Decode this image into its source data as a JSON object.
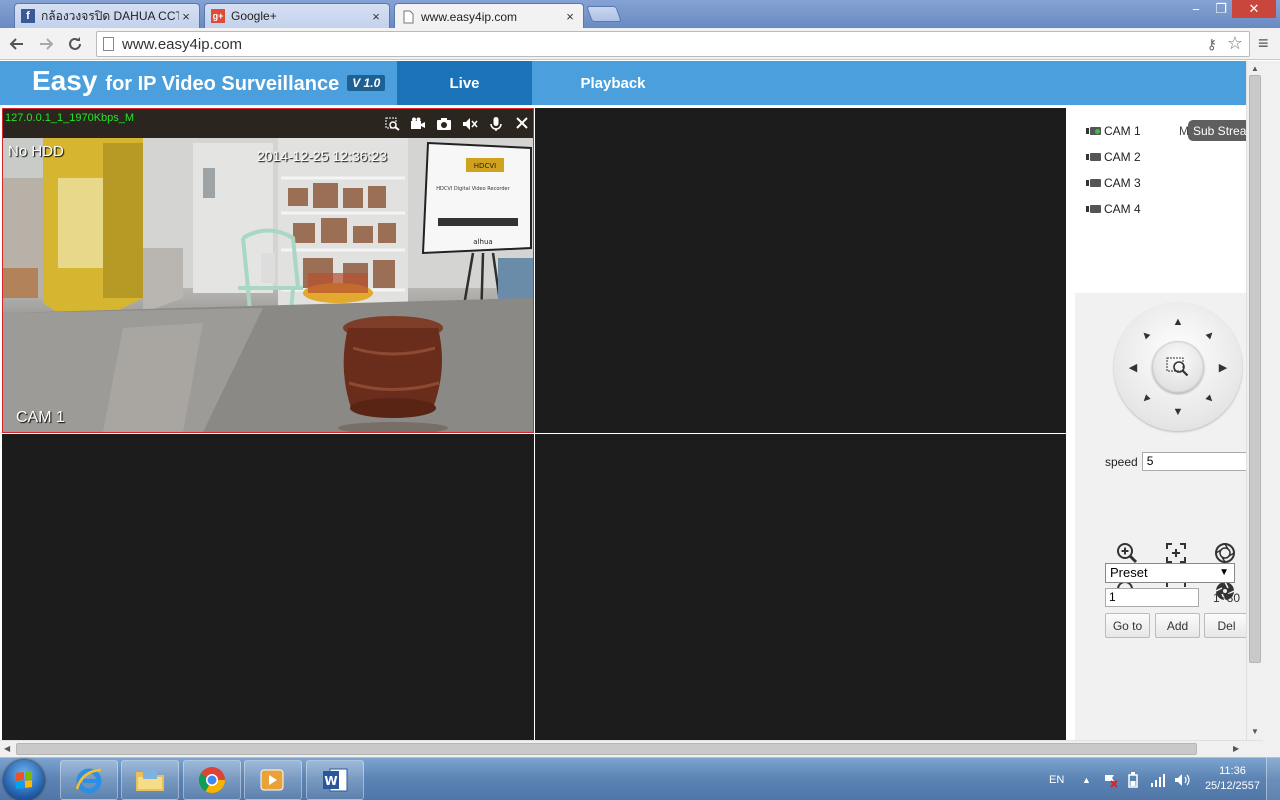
{
  "browser": {
    "tabs": [
      {
        "title": "กล้องวงจรปิด DAHUA CCTV",
        "favicon": "facebook-icon",
        "active": false
      },
      {
        "title": "Google+",
        "favicon": "google-plus-icon",
        "active": false
      },
      {
        "title": "www.easy4ip.com",
        "favicon": "page-icon",
        "active": true
      }
    ],
    "url": "www.easy4ip.com",
    "close_glyph": "×",
    "window_controls": [
      "−",
      "❐",
      "✕"
    ]
  },
  "app": {
    "logo_main": "Easy",
    "logo_rest": "for IP Video Surveillance",
    "version": "V 1.0",
    "nav": {
      "live": "Live",
      "playback": "Playback"
    },
    "accent": "#4b9fdc",
    "active_nav_color": "#1a72b8"
  },
  "video": {
    "stream_name": "127.0.0.1_1_1970Kbps_M",
    "hdd_status": "No HDD",
    "timestamp": "2014-12-25 12:36:23",
    "channel_label": "CAM 1",
    "toolbar_icons": [
      "zoom-region-icon",
      "record-icon",
      "snapshot-icon",
      "audio-mute-icon",
      "microphone-icon",
      "close-icon"
    ]
  },
  "cameras": [
    {
      "label": "CAM 1",
      "online": true
    },
    {
      "label": "CAM 2",
      "online": false
    },
    {
      "label": "CAM 3",
      "online": false
    },
    {
      "label": "CAM 4",
      "online": false
    }
  ],
  "stream_menu": {
    "main_label": "M",
    "sub_label": "Sub Strea"
  },
  "ptz": {
    "speed_label": "speed",
    "speed_value": "5",
    "preset_select": "Preset",
    "preset_value": "1",
    "preset_range": "1~80",
    "buttons": {
      "goto": "Go to",
      "add": "Add",
      "del": "Del"
    }
  },
  "taskbar": {
    "apps": [
      "windows-start-icon",
      "internet-explorer-icon",
      "file-explorer-icon",
      "chrome-icon",
      "media-player-icon",
      "word-icon"
    ],
    "language": "EN",
    "time": "11:36",
    "date": "25/12/2557"
  }
}
